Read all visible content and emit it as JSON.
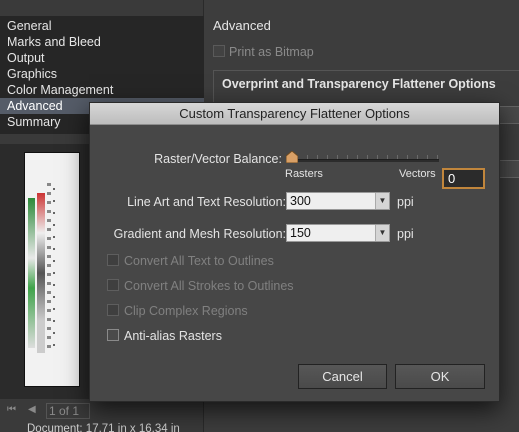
{
  "nav": {
    "items": [
      "General",
      "Marks and Bleed",
      "Output",
      "Graphics",
      "Color Management",
      "Advanced",
      "Summary"
    ],
    "selected_index": 5
  },
  "advanced_panel": {
    "title": "Advanced",
    "print_as_bitmap_label": "Print as Bitmap",
    "overprint_group_title": "Overprint and Transparency Flattener Options"
  },
  "preview": {
    "page_text": "1 of 1",
    "document_size": "Document: 17.71 in x 16.34 in"
  },
  "dialog": {
    "title": "Custom Transparency Flattener Options",
    "balance": {
      "label": "Raster/Vector Balance:",
      "value": "0",
      "slider_fraction": 0.0,
      "min_label": "Rasters",
      "max_label": "Vectors"
    },
    "line_art": {
      "label": "Line Art and Text Resolution:",
      "value": "300",
      "unit": "ppi"
    },
    "gradient": {
      "label": "Gradient and Mesh Resolution:",
      "value": "150",
      "unit": "ppi"
    },
    "options": [
      {
        "label": "Convert All Text to Outlines",
        "enabled": false,
        "checked": false
      },
      {
        "label": "Convert All Strokes to Outlines",
        "enabled": false,
        "checked": false
      },
      {
        "label": "Clip Complex Regions",
        "enabled": false,
        "checked": false
      },
      {
        "label": "Anti-alias Rasters",
        "enabled": true,
        "checked": false
      }
    ],
    "cancel_label": "Cancel",
    "ok_label": "OK"
  },
  "colors": {
    "background": "#3d3d3d",
    "dialog": "#474747",
    "selection": "#555c68",
    "focus_accent": "#c1863c"
  }
}
